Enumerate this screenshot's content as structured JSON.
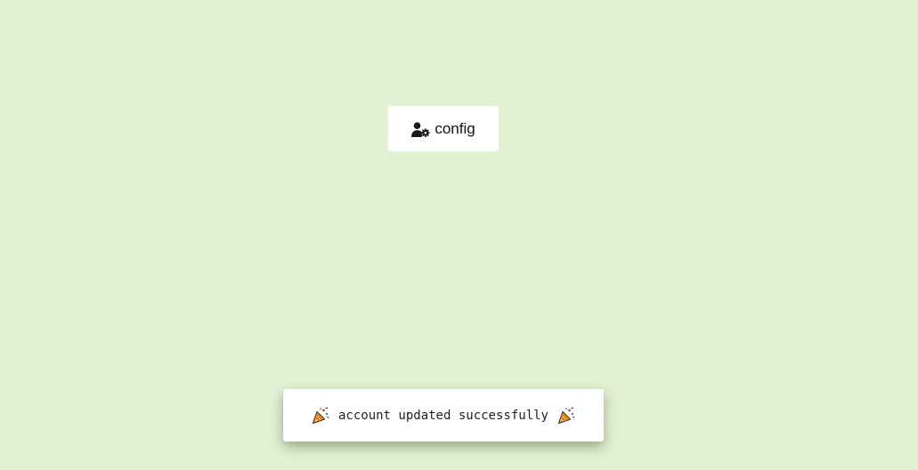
{
  "config_button": {
    "label": "config",
    "icon": "user-gear-icon"
  },
  "toast": {
    "message": "account updated successfully",
    "leading_icon": "party-popper-icon",
    "trailing_icon": "party-popper-icon"
  },
  "colors": {
    "background": "#e2f0d3",
    "surface": "#ffffff",
    "text": "#111111"
  }
}
